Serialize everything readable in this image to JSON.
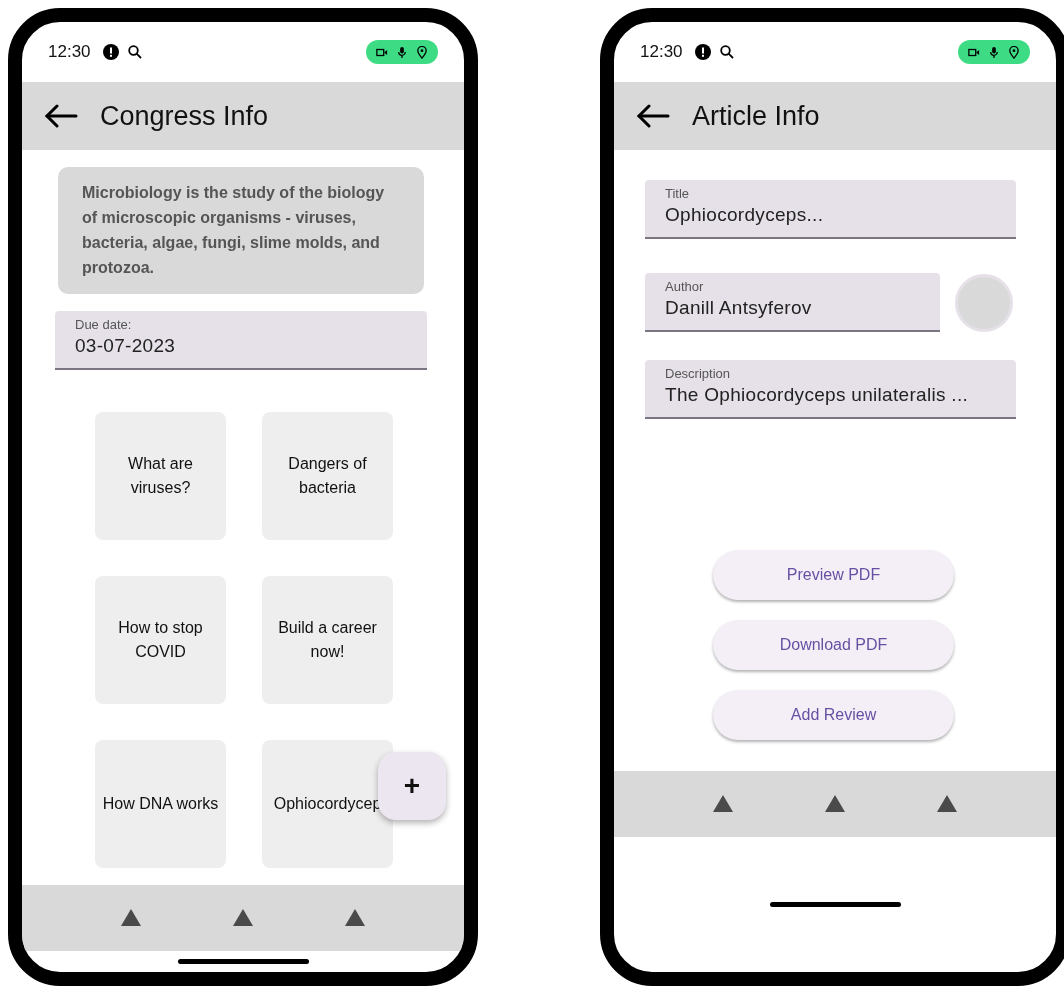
{
  "congress_screen": {
    "status_bar": {
      "time": "12:30"
    },
    "app_bar": {
      "title": "Congress Info"
    },
    "description": "Microbiology is the study of the biology of microscopic organisms - viruses, bacteria, algae, fungi, slime molds, and protozoa.",
    "due_date": {
      "label": "Due date:",
      "value": "03-07-2023"
    },
    "topics": [
      "What are viruses?",
      "Dangers of bacteria",
      "How to stop COVID",
      "Build a career now!",
      "How DNA works",
      "Ophiocordycep"
    ],
    "fab": {
      "label": "+"
    }
  },
  "article_screen": {
    "status_bar": {
      "time": "12:30"
    },
    "app_bar": {
      "title": "Article Info"
    },
    "fields": [
      {
        "kind": "plain",
        "label": "Title",
        "value": "Ophiocordyceps..."
      },
      {
        "kind": "avatar",
        "label": "Author",
        "value": "Danill Antsyferov"
      },
      {
        "kind": "plain",
        "label": "Description",
        "value": "The Ophiocordyceps unilateralis ..."
      }
    ],
    "buttons": [
      "Preview PDF",
      "Download PDF",
      "Add Review"
    ]
  }
}
